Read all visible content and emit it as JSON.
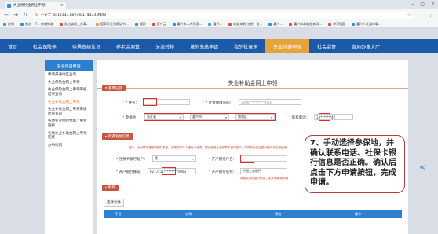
{
  "browser": {
    "tab_title": "失业保险金网上申领",
    "address": {
      "insecure_label": "不安全",
      "url": "sl.12333.gov.cn/174333.jhtml"
    },
    "bookmarks": [
      "应用",
      "首选一下，你就知道",
      "浙江省网上办事...",
      "国家职业资格证书...",
      "搜索",
      "资产云",
      "嘉兴市人力资源...",
      "嘉兴...",
      "欢迎来到 五险一金...",
      "嘉兴...",
      "嘉兴市政务服务网...",
      "学习强国",
      "嘉兴人社窗口事..."
    ]
  },
  "site_nav": {
    "items": [
      "首页",
      "社会保障卡",
      "待遇资格认证",
      "养老金测算",
      "关系转移",
      "境外免缴申请",
      "我的社保卡",
      "失业待遇申领",
      "社会监督",
      "各地办事大厅"
    ],
    "active_index": 7
  },
  "sidebar": {
    "header": "失业待遇申领",
    "items": [
      "申领开通地区查询",
      "失业保险金网上申领",
      "失业保险金网上申领审核结果查询",
      "失业补助金网上申领",
      "失业补助金网上申领审核结果查询",
      "各地失业保险金网上申领链接",
      "各地失业补助金网上申领链接",
      "办事指南"
    ],
    "active_index": 3
  },
  "form": {
    "title": "失业补助金网上申领",
    "section_basic": "基本信息",
    "name_label": "姓名：",
    "id_label": "社会保障号码：",
    "id_value": "3306**********1004",
    "insured_place_label": "参保地：",
    "province": "浙江省",
    "city": "嘉兴市",
    "district": "南湖区",
    "phone_label": "联系电话：",
    "phone_value": "13*******42",
    "section_pay": "待遇发放信息",
    "pay_tip": "提示：为保障待遇能够按时发放，请您填写本人银行卡信息，建议使用社会保障卡银行账户，同时务必保证银行账户可正常使用",
    "bank_name_label": "社保卡银行账户：",
    "bank_value": "是",
    "account_name_label": "开户银行户名：",
    "account_no_label": "开户银行账号：",
    "account_no_value": "6217211*********0003",
    "bank_branch_label": "开户银行名称：",
    "bank_branch_value": "中国工商银行",
    "bank_note": "请核实您的银行信息，如不需要请忽略",
    "section_attach": "附件",
    "file_button": "选择文件",
    "table_headers": [
      "序号",
      "名称",
      "预览",
      "操作"
    ]
  },
  "annotation": {
    "text": "7、手动选择参保地，并确认联系电话、社保卡银行信息是否正确。确认后点击下方申请按钮，完成申请。"
  },
  "colors": {
    "nav_blue": "#1a5aa8",
    "nav_active": "#e7a23a",
    "section_red": "#c8553e",
    "highlight_red": "#e02b2b"
  }
}
